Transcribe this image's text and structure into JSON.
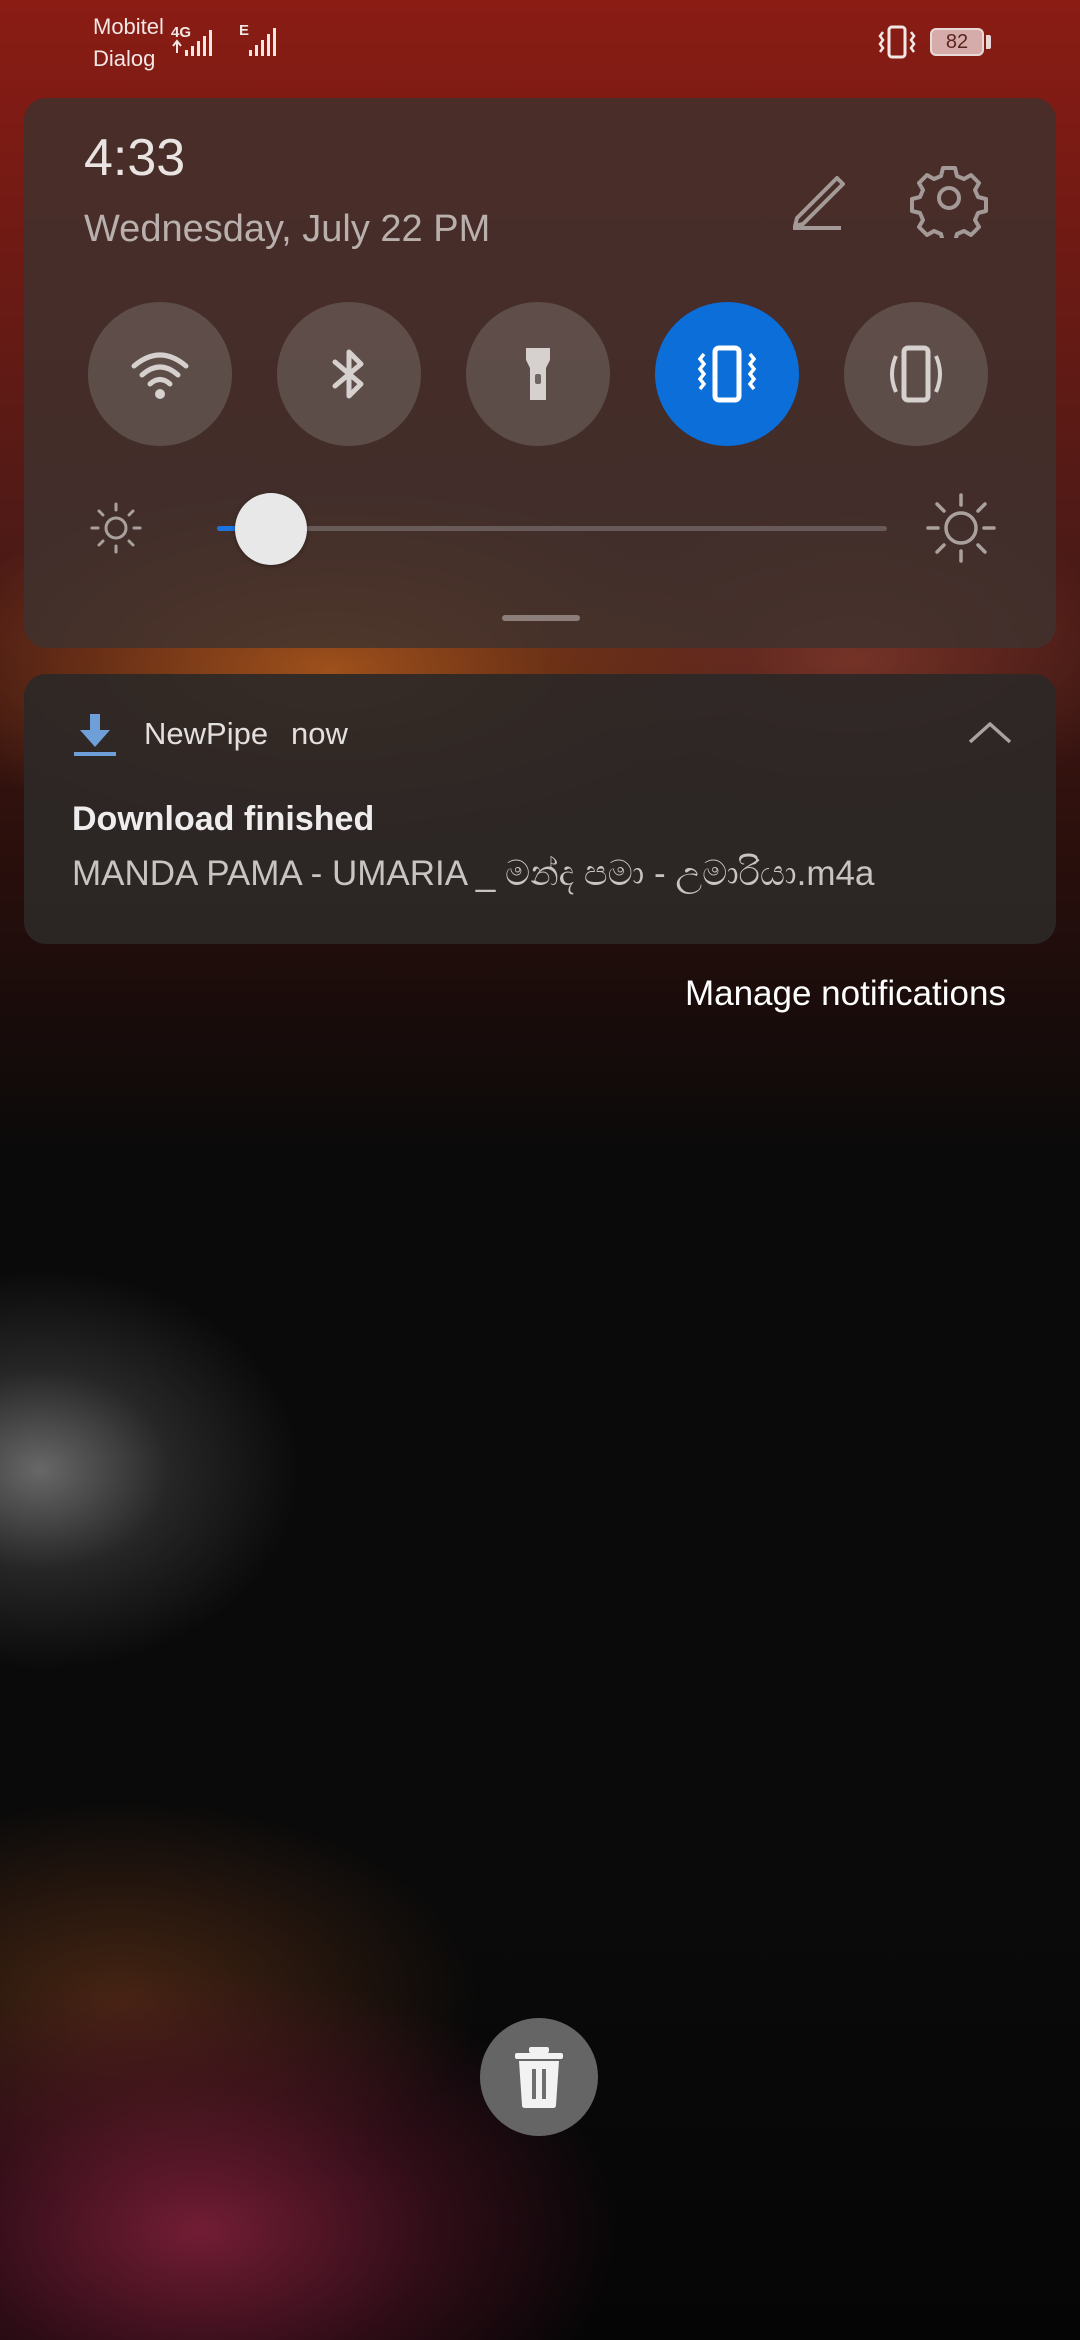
{
  "status_bar": {
    "carriers": [
      "Mobitel",
      "Dialog"
    ],
    "network_types": [
      "4G",
      "E"
    ],
    "battery_level": "82",
    "vibrate_icon": "vibrate-icon"
  },
  "quick_settings": {
    "time": "4:33",
    "date": "Wednesday, July 22  PM",
    "edit_icon": "pencil-icon",
    "settings_icon": "gear-icon",
    "tiles": [
      {
        "name": "wifi",
        "icon": "wifi-icon",
        "active": false
      },
      {
        "name": "bluetooth",
        "icon": "bluetooth-icon",
        "active": false
      },
      {
        "name": "flashlight",
        "icon": "flashlight-icon",
        "active": false
      },
      {
        "name": "vibrate",
        "icon": "vibrate-icon",
        "active": true
      },
      {
        "name": "auto-rotate",
        "icon": "rotate-icon",
        "active": false
      }
    ],
    "brightness": 0.08,
    "accent_color": "#0b6ed9"
  },
  "notification": {
    "app_name": "NewPipe",
    "time": "now",
    "icon": "download-icon",
    "expand_icon": "chevron-up-icon",
    "title": "Download finished",
    "text": "MANDA PAMA - UMARIA _ මන්ද පමා - උමාරියා.m4a"
  },
  "manage_notifications": "Manage notifications",
  "clear_icon": "trash-icon"
}
